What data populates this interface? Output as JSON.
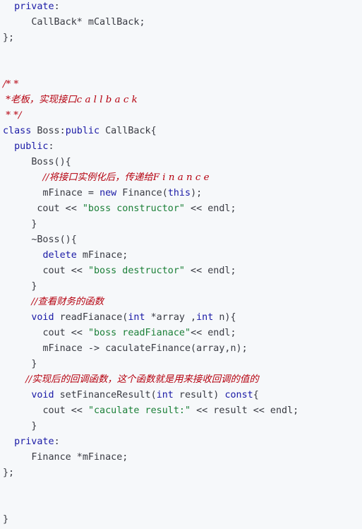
{
  "lines": [
    {
      "indent": "  ",
      "parts": [
        {
          "cls": "kw",
          "text": "private"
        },
        {
          "cls": "",
          "text": ":"
        }
      ]
    },
    {
      "indent": "     ",
      "parts": [
        {
          "cls": "",
          "text": "CallBack* mCallBack;"
        }
      ]
    },
    {
      "indent": "",
      "parts": [
        {
          "cls": "",
          "text": "};"
        }
      ]
    },
    {
      "indent": "",
      "parts": []
    },
    {
      "indent": "",
      "parts": []
    },
    {
      "indent": "",
      "parts": [
        {
          "cls": "cm",
          "text": "/* *"
        }
      ]
    },
    {
      "indent": "",
      "parts": [
        {
          "cls": "cm",
          "text": " *老板，实现接口c a l l b a c k"
        }
      ]
    },
    {
      "indent": "",
      "parts": [
        {
          "cls": "cm",
          "text": " * */"
        }
      ]
    },
    {
      "indent": "",
      "parts": [
        {
          "cls": "kw",
          "text": "class"
        },
        {
          "cls": "",
          "text": " Boss:"
        },
        {
          "cls": "kw",
          "text": "public"
        },
        {
          "cls": "",
          "text": " CallBack{"
        }
      ]
    },
    {
      "indent": "  ",
      "parts": [
        {
          "cls": "kw",
          "text": "public"
        },
        {
          "cls": "",
          "text": ":"
        }
      ]
    },
    {
      "indent": "     ",
      "parts": [
        {
          "cls": "",
          "text": "Boss(){"
        }
      ]
    },
    {
      "indent": "       ",
      "parts": [
        {
          "cls": "cm",
          "text": "//将接口实例化后，传递给F i n a n c e"
        }
      ]
    },
    {
      "indent": "       ",
      "parts": [
        {
          "cls": "",
          "text": "mFinace = "
        },
        {
          "cls": "kw",
          "text": "new"
        },
        {
          "cls": "",
          "text": " Finance("
        },
        {
          "cls": "kw",
          "text": "this"
        },
        {
          "cls": "",
          "text": ");"
        }
      ]
    },
    {
      "indent": "      ",
      "parts": [
        {
          "cls": "",
          "text": "cout << "
        },
        {
          "cls": "str",
          "text": "\"boss constructor\""
        },
        {
          "cls": "",
          "text": " << endl;"
        }
      ]
    },
    {
      "indent": "     ",
      "parts": [
        {
          "cls": "",
          "text": "}"
        }
      ]
    },
    {
      "indent": "     ",
      "parts": [
        {
          "cls": "",
          "text": "~Boss(){"
        }
      ]
    },
    {
      "indent": "       ",
      "parts": [
        {
          "cls": "kw",
          "text": "delete"
        },
        {
          "cls": "",
          "text": " mFinace;"
        }
      ]
    },
    {
      "indent": "       ",
      "parts": [
        {
          "cls": "",
          "text": "cout << "
        },
        {
          "cls": "str",
          "text": "\"boss destructor\""
        },
        {
          "cls": "",
          "text": " << endl;"
        }
      ]
    },
    {
      "indent": "     ",
      "parts": [
        {
          "cls": "",
          "text": "}"
        }
      ]
    },
    {
      "indent": "     ",
      "parts": [
        {
          "cls": "cm",
          "text": "//查看财务的函数"
        }
      ]
    },
    {
      "indent": "     ",
      "parts": [
        {
          "cls": "kw",
          "text": "void"
        },
        {
          "cls": "",
          "text": " readFianace("
        },
        {
          "cls": "kw",
          "text": "int"
        },
        {
          "cls": "",
          "text": " *array ,"
        },
        {
          "cls": "kw",
          "text": "int"
        },
        {
          "cls": "",
          "text": " n){"
        }
      ]
    },
    {
      "indent": "       ",
      "parts": [
        {
          "cls": "",
          "text": "cout << "
        },
        {
          "cls": "str",
          "text": "\"boss readFianace\""
        },
        {
          "cls": "",
          "text": "<< endl;"
        }
      ]
    },
    {
      "indent": "       ",
      "parts": [
        {
          "cls": "",
          "text": "mFinace -> caculateFinance(array,n);"
        }
      ]
    },
    {
      "indent": "     ",
      "parts": [
        {
          "cls": "",
          "text": "}"
        }
      ]
    },
    {
      "indent": "    ",
      "parts": [
        {
          "cls": "cm",
          "text": "//实现后的回调函数，这个函数就是用来接收回调的值的"
        }
      ]
    },
    {
      "indent": "     ",
      "parts": [
        {
          "cls": "kw",
          "text": "void"
        },
        {
          "cls": "",
          "text": " setFinanceResult("
        },
        {
          "cls": "kw",
          "text": "int"
        },
        {
          "cls": "",
          "text": " result) "
        },
        {
          "cls": "kw",
          "text": "const"
        },
        {
          "cls": "",
          "text": "{"
        }
      ]
    },
    {
      "indent": "       ",
      "parts": [
        {
          "cls": "",
          "text": "cout << "
        },
        {
          "cls": "str",
          "text": "\"caculate result:\""
        },
        {
          "cls": "",
          "text": " << result << endl;"
        }
      ]
    },
    {
      "indent": "     ",
      "parts": [
        {
          "cls": "",
          "text": "}"
        }
      ]
    },
    {
      "indent": "  ",
      "parts": [
        {
          "cls": "kw",
          "text": "private"
        },
        {
          "cls": "",
          "text": ":"
        }
      ]
    },
    {
      "indent": "     ",
      "parts": [
        {
          "cls": "",
          "text": "Finance *mFinace;"
        }
      ]
    },
    {
      "indent": "",
      "parts": [
        {
          "cls": "",
          "text": "};"
        }
      ]
    },
    {
      "indent": "",
      "parts": []
    },
    {
      "indent": "",
      "parts": []
    },
    {
      "indent": "",
      "parts": [
        {
          "cls": "",
          "text": "}"
        }
      ]
    }
  ]
}
